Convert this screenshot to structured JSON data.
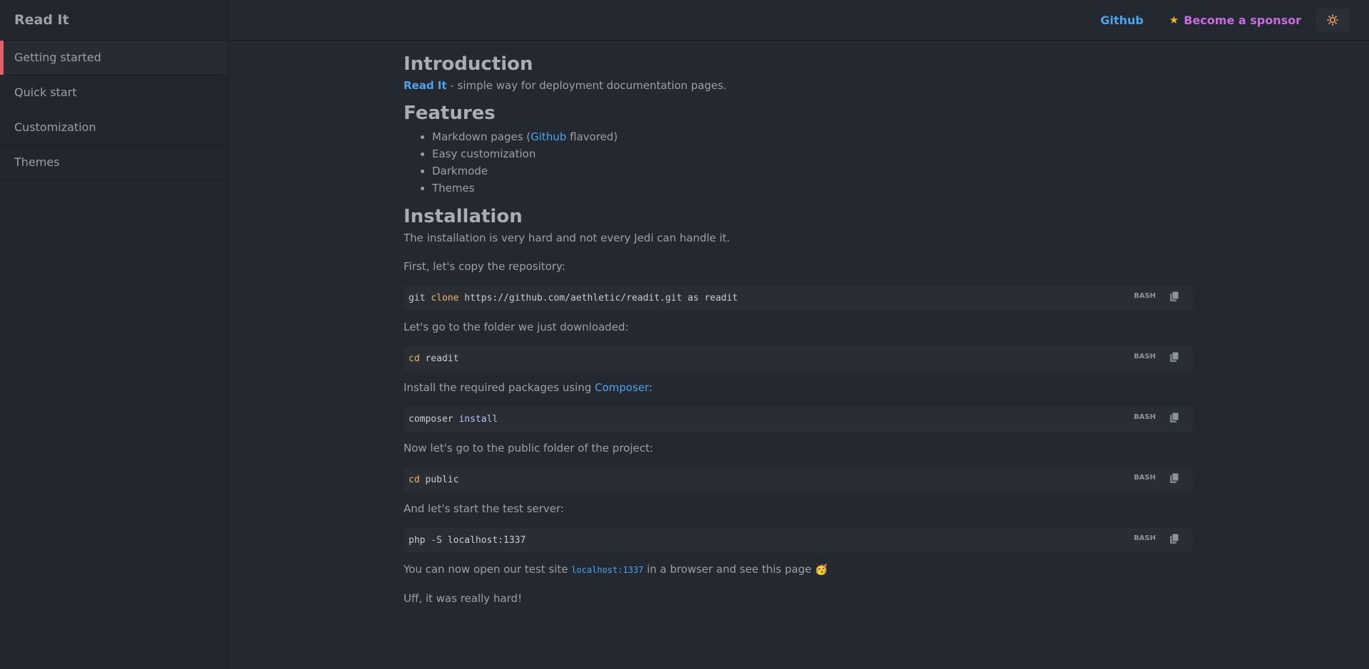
{
  "brand": "Read It",
  "sidebar": {
    "items": [
      {
        "label": "Getting started"
      },
      {
        "label": "Quick start"
      },
      {
        "label": "Customization"
      },
      {
        "label": "Themes"
      }
    ]
  },
  "header": {
    "github_label": "Github",
    "sponsor_label": "Become a sponsor",
    "theme_toggle_icon": "sun-icon"
  },
  "intro": {
    "title": "Introduction",
    "link": "Read It",
    "text": " - simple way for deployment documentation pages."
  },
  "features": {
    "title": "Features",
    "items": {
      "markdown_pre": "Markdown pages (",
      "markdown_link": "Github",
      "markdown_post": " flavored)",
      "customization": "Easy customization",
      "darkmode": "Darkmode",
      "themes": "Themes"
    }
  },
  "installation": {
    "title": "Installation",
    "p1": "The installation is very hard and not every Jedi can handle it.",
    "p2": "First, let's copy the repository:",
    "code1": {
      "a": "git ",
      "kw": "clone",
      "b": " https://github.com/aethletic/readit.git as readit",
      "lang": "BASH"
    },
    "p3": "Let's go to the folder we just downloaded:",
    "code2": {
      "kw": "cd",
      "b": " readit",
      "lang": "BASH"
    },
    "p4_pre": "Install the required packages using ",
    "p4_link": "Composer",
    "p4_post": ":",
    "code3": {
      "a": "composer ",
      "kw": "install",
      "lang": "BASH"
    },
    "p5": "Now let's go to the public folder of the project:",
    "code4": {
      "kw": "cd",
      "b": " public",
      "lang": "BASH"
    },
    "p6": "And let's start the test server:",
    "code5": {
      "a": "php -S localhost:1337",
      "lang": "BASH"
    },
    "p7_pre": "You can now open our test site ",
    "p7_code": "localhost:1337",
    "p7_post": " in a browser and see this page 🥳",
    "p8": "Uff, it was really hard!"
  },
  "colors": {
    "accent_link": "#4ea3ee",
    "sponsor": "#c96ce0",
    "active_marker": "#e0606a",
    "background": "#242830"
  }
}
